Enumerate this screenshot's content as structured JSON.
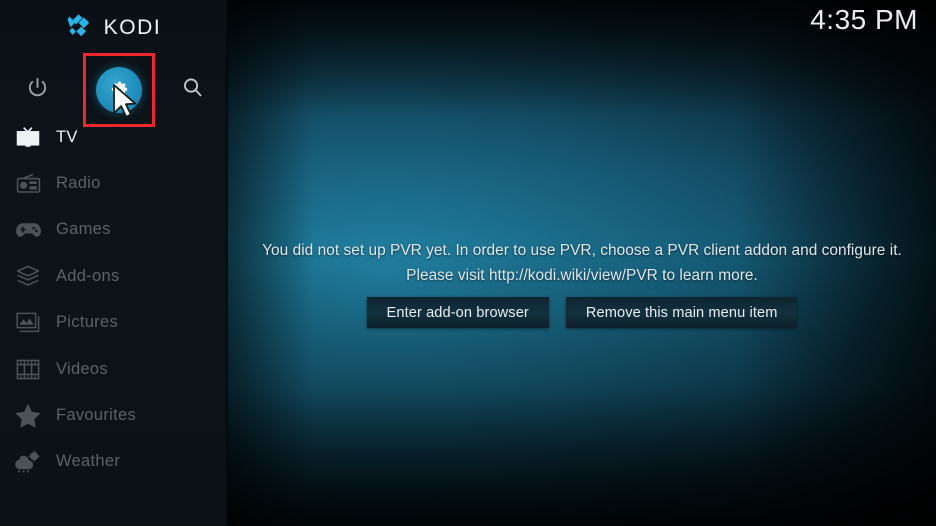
{
  "app": {
    "brand": "KODI",
    "logo_icon": "kodi-logo-icon",
    "brand_color": "#27b4e6"
  },
  "header": {
    "clock": "4:35 PM"
  },
  "sidebar": {
    "quick_actions": [
      {
        "name": "power-icon",
        "label": "Power"
      },
      {
        "name": "gear-icon",
        "label": "Settings",
        "highlighted": true
      },
      {
        "name": "search-icon",
        "label": "Search"
      }
    ],
    "items": [
      {
        "label": "TV",
        "icon": "tv-icon",
        "selected": true
      },
      {
        "label": "Radio",
        "icon": "radio-icon",
        "selected": false
      },
      {
        "label": "Games",
        "icon": "gamepad-icon",
        "selected": false
      },
      {
        "label": "Add-ons",
        "icon": "addons-box-icon",
        "selected": false
      },
      {
        "label": "Pictures",
        "icon": "pictures-icon",
        "selected": false
      },
      {
        "label": "Videos",
        "icon": "videos-film-icon",
        "selected": false
      },
      {
        "label": "Favourites",
        "icon": "star-icon",
        "selected": false
      },
      {
        "label": "Weather",
        "icon": "weather-icon",
        "selected": false
      }
    ]
  },
  "main": {
    "message": "You did not set up PVR yet. In order to use PVR, choose a PVR client addon and configure it. Please visit http://kodi.wiki/view/PVR to learn more.",
    "buttons": [
      {
        "label": "Enter add-on browser"
      },
      {
        "label": "Remove this main menu item"
      }
    ]
  },
  "annotation": {
    "highlight_color": "#f0262e",
    "target": "gear-icon",
    "cursor": "arrow-cursor"
  }
}
